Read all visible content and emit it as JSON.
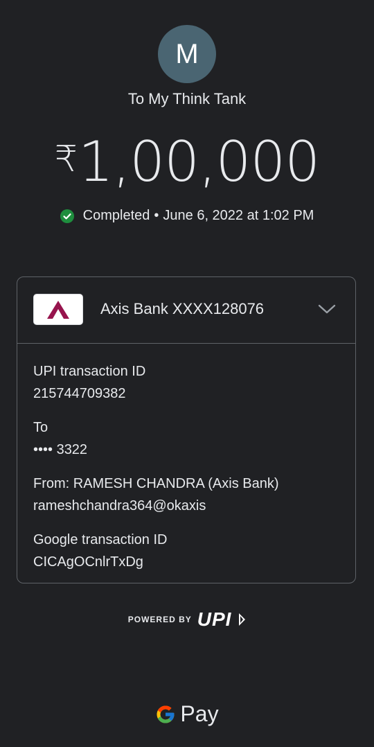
{
  "payee": {
    "avatar_letter": "M",
    "avatar_color": "#4a6572",
    "title": "To My Think Tank"
  },
  "amount": {
    "currency_symbol": "₹",
    "value": "1,00,000"
  },
  "status": {
    "icon": "check-circle-icon",
    "color": "#1e8e3e",
    "text": "Completed",
    "separator": "•",
    "datetime": "June 6, 2022 at 1:02 PM"
  },
  "account": {
    "bank_name": "Axis Bank XXXX128076",
    "logo_icon": "axis-bank-logo",
    "logo_color": "#97144d",
    "expand_icon": "chevron-down-icon"
  },
  "details": [
    {
      "label": "UPI transaction ID",
      "value": "215744709382"
    },
    {
      "label": "To",
      "value": "•••• 3322"
    },
    {
      "label": "From: RAMESH CHANDRA (Axis Bank)",
      "value": "rameshchandra364@okaxis"
    },
    {
      "label": "Google transaction ID",
      "value": "CICAgOCnlrTxDg"
    }
  ],
  "footer": {
    "powered_by": "POWERED BY",
    "upi_logo": "UPI",
    "gpay_logo": "Pay"
  }
}
